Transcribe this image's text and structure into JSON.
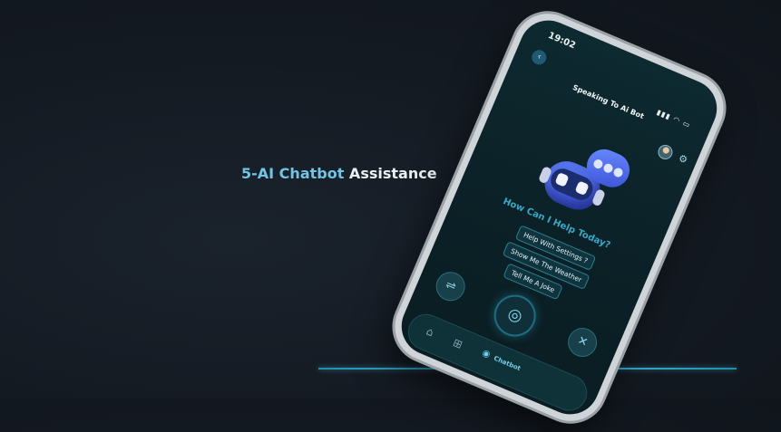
{
  "headline": {
    "accent_text": "5-AI Chatbot",
    "rest_text": " Assistance"
  },
  "phone": {
    "status_time": "19:02",
    "title": "Speaking To Ai Bot",
    "question": "How Can I Help Today?",
    "suggestions": [
      "Help With Settings ?",
      "Show Me The Weather",
      "Tell Me A Joke"
    ],
    "tabs": {
      "chatbot_label": "Chatbot"
    },
    "icons": {
      "back": "chevron-left-icon",
      "settings": "gear-icon",
      "filters": "sliders-icon",
      "mic": "mic-icon",
      "close": "close-icon",
      "home": "home-icon",
      "apps": "grid-icon",
      "chatbot": "chatbot-icon"
    }
  },
  "colors": {
    "accent": "#6fc5e3",
    "question": "#3aa8c8",
    "background": "#141a22"
  }
}
